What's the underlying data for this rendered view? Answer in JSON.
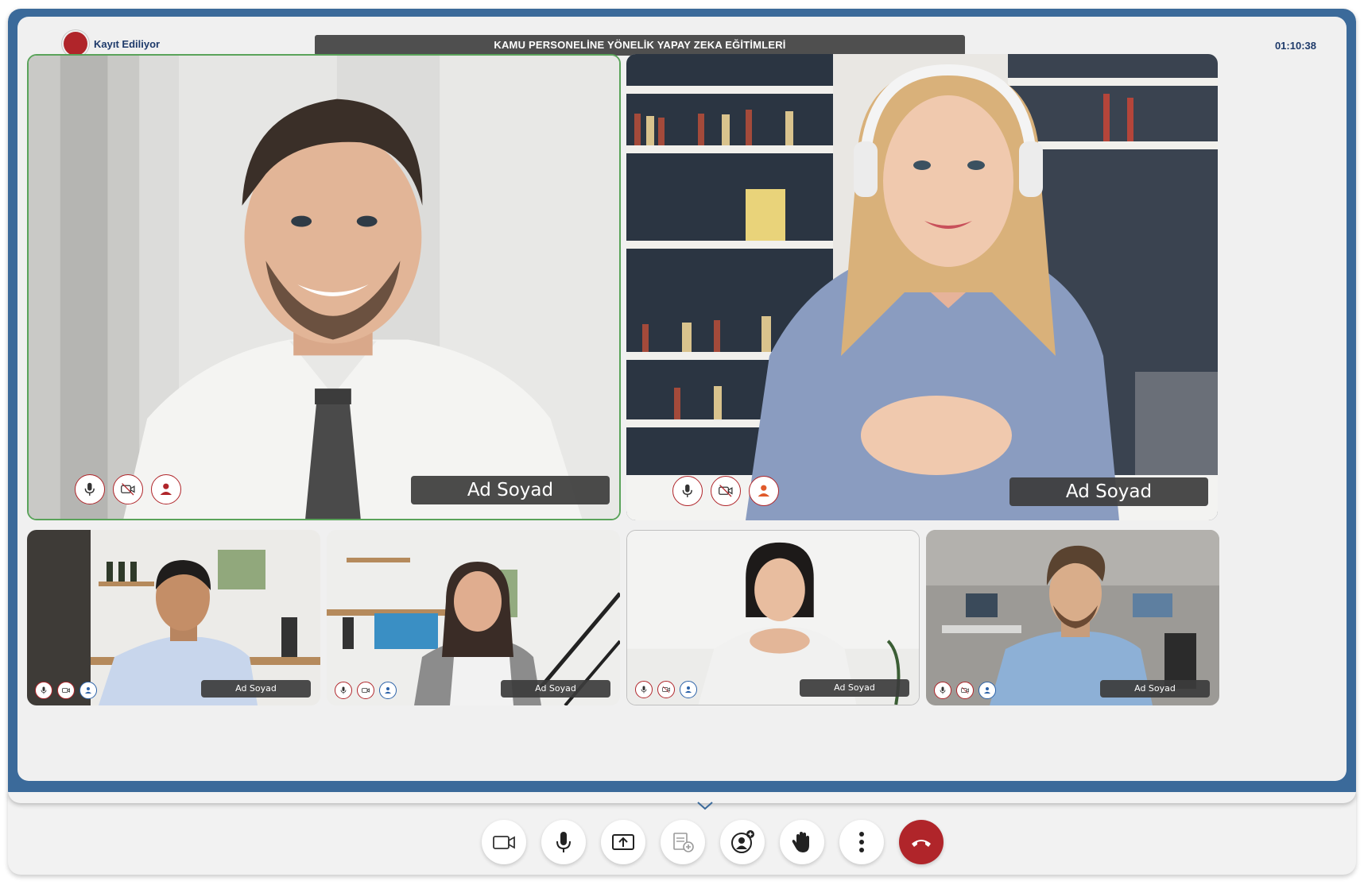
{
  "header": {
    "recording_label": "Kayıt Ediliyor",
    "meeting_title": "KAMU PERSONELİNE YÖNELİK YAPAY ZEKA EĞİTİMLERİ",
    "elapsed_time": "01:10:38"
  },
  "participants": [
    {
      "name": "Ad Soyad",
      "size": "large",
      "active_speaker": true,
      "scene": "man-office"
    },
    {
      "name": "Ad Soyad",
      "size": "large",
      "active_speaker": false,
      "scene": "woman-headphones-library"
    },
    {
      "name": "Ad Soyad",
      "size": "small",
      "active_speaker": false,
      "scene": "man-cafe"
    },
    {
      "name": "Ad Soyad",
      "size": "small",
      "active_speaker": false,
      "scene": "woman-cafe-stairs"
    },
    {
      "name": "Ad Soyad",
      "size": "small",
      "active_speaker": false,
      "scene": "woman-white-room"
    },
    {
      "name": "Ad Soyad",
      "size": "small",
      "active_speaker": false,
      "scene": "man-open-office"
    }
  ],
  "tile_controls": [
    "microphone-icon",
    "camera-icon",
    "person-icon"
  ],
  "toolbar": {
    "buttons": [
      "camera-icon",
      "microphone-icon",
      "share-screen-icon",
      "add-document-icon",
      "add-participant-icon",
      "raise-hand-icon",
      "more-options-icon",
      "hang-up-icon"
    ]
  },
  "colors": {
    "frame_blue": "#3b6a9a",
    "record_red": "#b0252a",
    "active_border": "#5aa35a",
    "header_text": "#1e3a6a",
    "title_bar": "#4f4f4f"
  }
}
